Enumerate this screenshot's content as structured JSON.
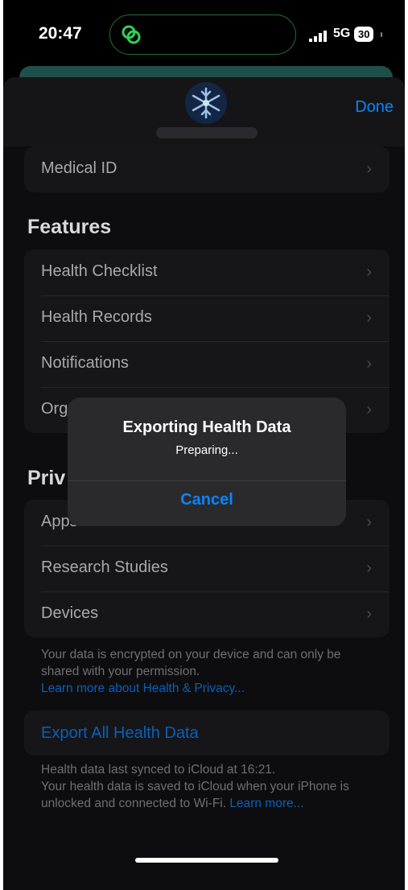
{
  "status_bar": {
    "time": "20:47",
    "network": "5G",
    "battery": "30"
  },
  "nav": {
    "done_label": "Done"
  },
  "top_card": {
    "items": [
      {
        "label": "Medical ID"
      }
    ]
  },
  "features": {
    "title": "Features",
    "items": [
      {
        "label": "Health Checklist"
      },
      {
        "label": "Health Records"
      },
      {
        "label": "Notifications"
      },
      {
        "label": "Org"
      }
    ]
  },
  "privacy": {
    "title": "Priv",
    "items": [
      {
        "label": "Apps"
      },
      {
        "label": "Research Studies"
      },
      {
        "label": "Devices"
      }
    ],
    "footer_text": "Your data is encrypted on your device and can only be shared with your permission.",
    "footer_link": "Learn more about Health & Privacy..."
  },
  "export": {
    "label": "Export All Health Data",
    "sync_line": "Health data last synced to iCloud at 16:21.",
    "note_text": "Your health data is saved to iCloud when your iPhone is unlocked and connected to Wi-Fi.",
    "note_link": "Learn more..."
  },
  "alert": {
    "title": "Exporting Health Data",
    "message": "Preparing...",
    "cancel_label": "Cancel"
  },
  "icons": {
    "chevron": "chevron-right-icon",
    "island": "link-rings-icon",
    "avatar": "snowflake-avatar"
  },
  "colors": {
    "accent": "#0a84ff",
    "island_accent": "#30d158",
    "background": "#000000"
  }
}
